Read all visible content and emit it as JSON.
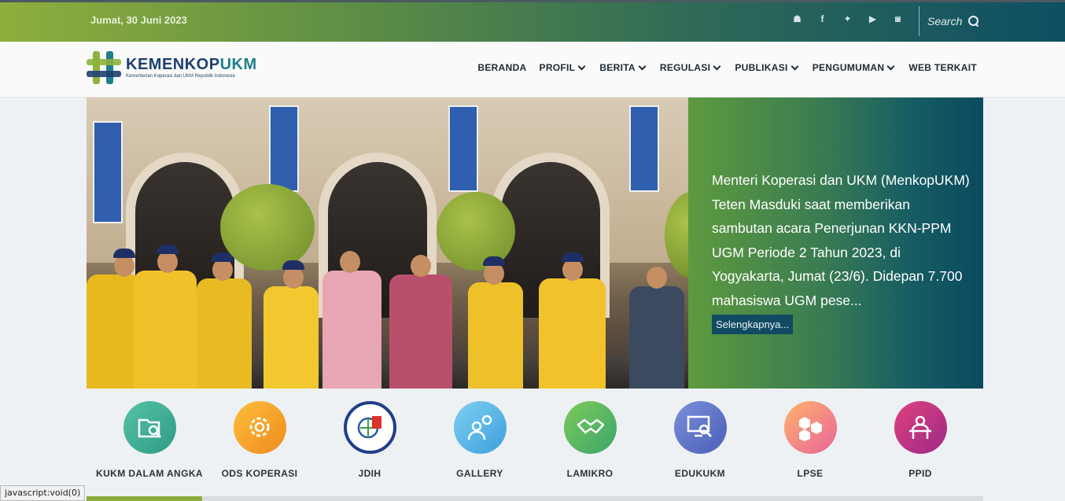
{
  "topbar": {
    "date": "Jumat, 30 Juni 2023",
    "socials": [
      {
        "icon": "android-icon",
        "glyph": "☗"
      },
      {
        "icon": "facebook-icon",
        "glyph": "f"
      },
      {
        "icon": "twitter-icon",
        "glyph": "✦"
      },
      {
        "icon": "youtube-icon",
        "glyph": "▶"
      },
      {
        "icon": "instagram-icon",
        "glyph": "◙"
      }
    ],
    "search_placeholder": "Search"
  },
  "logo": {
    "name_part1": "KEMENKOP",
    "name_part2": "UKM",
    "tagline": "Kementerian Koperasi dan UKM Republik Indonesia"
  },
  "nav": {
    "items": [
      {
        "label": "BERANDA",
        "dropdown": false
      },
      {
        "label": "PROFIL",
        "dropdown": true
      },
      {
        "label": "BERITA",
        "dropdown": true
      },
      {
        "label": "REGULASI",
        "dropdown": true
      },
      {
        "label": "PUBLIKASI",
        "dropdown": true
      },
      {
        "label": "PENGUMUMAN",
        "dropdown": true
      },
      {
        "label": "WEB TERKAIT",
        "dropdown": false
      }
    ]
  },
  "hero": {
    "caption": "Menteri Koperasi dan UKM (MenkopUKM) Teten Masduki saat memberikan sambutan acara Penerjunan KKN-PPM UGM Periode 2 Tahun 2023, di Yogyakarta, Jumat (23/6). Didepan 7.700 mahasiswa UGM pese...",
    "more_label": "Selengkapnya..."
  },
  "quick_links": [
    {
      "label": "KUKM DALAM ANGKA",
      "icon": "folder-search-icon",
      "color": "#3db39e"
    },
    {
      "label": "ODS KOPERASI",
      "icon": "gear-icon",
      "color": "#f5a623"
    },
    {
      "label": "JDIH",
      "icon": "jdih-logo-icon",
      "color": "#ffffff"
    },
    {
      "label": "GALLERY",
      "icon": "user-idea-icon",
      "color": "#4fb6e8"
    },
    {
      "label": "LAMIKRO",
      "icon": "handshake-icon",
      "color": "#5dbb63"
    },
    {
      "label": "EDUKUKM",
      "icon": "monitor-search-icon",
      "color": "#5a6fc4"
    },
    {
      "label": "LPSE",
      "icon": "hexagons-icon",
      "color": "#f07aa0"
    },
    {
      "label": "PPID",
      "icon": "person-desk-icon",
      "color": "#c2287a"
    }
  ],
  "status_bar": "javascript:void(0)"
}
